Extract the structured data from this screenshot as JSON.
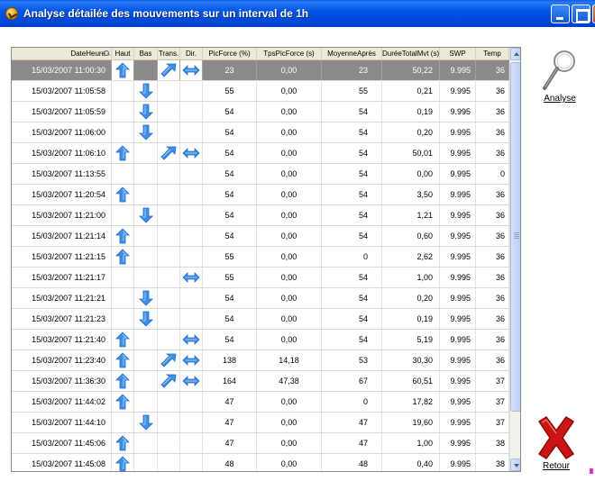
{
  "window": {
    "title": "Analyse détailée des mouvements sur un interval de 1h"
  },
  "columns": [
    "DateHeure",
    "Haut",
    "Bas",
    "Trans.",
    "Dir.",
    "PicForce (%)",
    "TpsPicForce (s)",
    "MoyenneAprès",
    "DuréeTotalMvt (s)",
    "SWP",
    "Temp"
  ],
  "icons": {
    "haut": "up-arrow-icon",
    "bas": "down-arrow-icon",
    "trans": "diagonal-arrow-icon",
    "dir": "left-right-arrow-icon",
    "sort": "search-sort-icon",
    "analyse": "magnifier-icon",
    "retour": "red-cross-icon"
  },
  "colors": {
    "arrow": "#3a8fe8",
    "selected_row": "#8a8a8a",
    "cross": "#cc1414"
  },
  "rows": [
    {
      "date": "15/03/2007 11:00:30",
      "haut": true,
      "bas": false,
      "trans": true,
      "dir": true,
      "pic": "23",
      "tps": "0,00",
      "moy": "23",
      "duree": "50,22",
      "swp": "9.995",
      "temp": "36",
      "selected": true
    },
    {
      "date": "15/03/2007 11:05:58",
      "haut": false,
      "bas": true,
      "trans": false,
      "dir": false,
      "pic": "55",
      "tps": "0,00",
      "moy": "55",
      "duree": "0,21",
      "swp": "9.995",
      "temp": "36"
    },
    {
      "date": "15/03/2007 11:05:59",
      "haut": false,
      "bas": true,
      "trans": false,
      "dir": false,
      "pic": "54",
      "tps": "0,00",
      "moy": "54",
      "duree": "0,19",
      "swp": "9.995",
      "temp": "36"
    },
    {
      "date": "15/03/2007 11:06:00",
      "haut": false,
      "bas": true,
      "trans": false,
      "dir": false,
      "pic": "54",
      "tps": "0,00",
      "moy": "54",
      "duree": "0,20",
      "swp": "9.995",
      "temp": "36"
    },
    {
      "date": "15/03/2007 11:06:10",
      "haut": true,
      "bas": false,
      "trans": true,
      "dir": true,
      "pic": "54",
      "tps": "0,00",
      "moy": "54",
      "duree": "50,01",
      "swp": "9.995",
      "temp": "36"
    },
    {
      "date": "15/03/2007 11:13:55",
      "haut": false,
      "bas": false,
      "trans": false,
      "dir": false,
      "pic": "54",
      "tps": "0,00",
      "moy": "54",
      "duree": "0,00",
      "swp": "9.995",
      "temp": "0"
    },
    {
      "date": "15/03/2007 11:20:54",
      "haut": true,
      "bas": false,
      "trans": false,
      "dir": false,
      "pic": "54",
      "tps": "0,00",
      "moy": "54",
      "duree": "3,50",
      "swp": "9.995",
      "temp": "36"
    },
    {
      "date": "15/03/2007 11:21:00",
      "haut": false,
      "bas": true,
      "trans": false,
      "dir": false,
      "pic": "54",
      "tps": "0,00",
      "moy": "54",
      "duree": "1,21",
      "swp": "9.995",
      "temp": "36"
    },
    {
      "date": "15/03/2007 11:21:14",
      "haut": true,
      "bas": false,
      "trans": false,
      "dir": false,
      "pic": "54",
      "tps": "0,00",
      "moy": "54",
      "duree": "0,60",
      "swp": "9.995",
      "temp": "36"
    },
    {
      "date": "15/03/2007 11:21:15",
      "haut": true,
      "bas": false,
      "trans": false,
      "dir": false,
      "pic": "55",
      "tps": "0,00",
      "moy": "0",
      "duree": "2,62",
      "swp": "9.995",
      "temp": "36"
    },
    {
      "date": "15/03/2007 11:21:17",
      "haut": false,
      "bas": false,
      "trans": false,
      "dir": true,
      "pic": "55",
      "tps": "0,00",
      "moy": "54",
      "duree": "1,00",
      "swp": "9.995",
      "temp": "36"
    },
    {
      "date": "15/03/2007 11:21:21",
      "haut": false,
      "bas": true,
      "trans": false,
      "dir": false,
      "pic": "54",
      "tps": "0,00",
      "moy": "54",
      "duree": "0,20",
      "swp": "9.995",
      "temp": "36"
    },
    {
      "date": "15/03/2007 11:21:23",
      "haut": false,
      "bas": true,
      "trans": false,
      "dir": false,
      "pic": "54",
      "tps": "0,00",
      "moy": "54",
      "duree": "0,19",
      "swp": "9.995",
      "temp": "36"
    },
    {
      "date": "15/03/2007 11:21:40",
      "haut": true,
      "bas": false,
      "trans": false,
      "dir": true,
      "pic": "54",
      "tps": "0,00",
      "moy": "54",
      "duree": "5,19",
      "swp": "9.995",
      "temp": "36"
    },
    {
      "date": "15/03/2007 11:23:40",
      "haut": true,
      "bas": false,
      "trans": true,
      "dir": true,
      "pic": "138",
      "tps": "14,18",
      "moy": "53",
      "duree": "30,30",
      "swp": "9.995",
      "temp": "36"
    },
    {
      "date": "15/03/2007 11:36:30",
      "haut": true,
      "bas": false,
      "trans": true,
      "dir": true,
      "pic": "164",
      "tps": "47,38",
      "moy": "67",
      "duree": "60,51",
      "swp": "9.995",
      "temp": "37"
    },
    {
      "date": "15/03/2007 11:44:02",
      "haut": true,
      "bas": false,
      "trans": false,
      "dir": false,
      "pic": "47",
      "tps": "0,00",
      "moy": "0",
      "duree": "17,82",
      "swp": "9.995",
      "temp": "37"
    },
    {
      "date": "15/03/2007 11:44:10",
      "haut": false,
      "bas": true,
      "trans": false,
      "dir": false,
      "pic": "47",
      "tps": "0,00",
      "moy": "47",
      "duree": "19,60",
      "swp": "9.995",
      "temp": "37"
    },
    {
      "date": "15/03/2007 11:45:06",
      "haut": true,
      "bas": false,
      "trans": false,
      "dir": false,
      "pic": "47",
      "tps": "0,00",
      "moy": "47",
      "duree": "1,00",
      "swp": "9.995",
      "temp": "38"
    },
    {
      "date": "15/03/2007 11:45:08",
      "haut": true,
      "bas": false,
      "trans": false,
      "dir": false,
      "pic": "48",
      "tps": "0,00",
      "moy": "48",
      "duree": "0,40",
      "swp": "9.995",
      "temp": "38"
    }
  ],
  "actions": {
    "analyse_label": "Analyse",
    "retour_label": "Retour"
  }
}
